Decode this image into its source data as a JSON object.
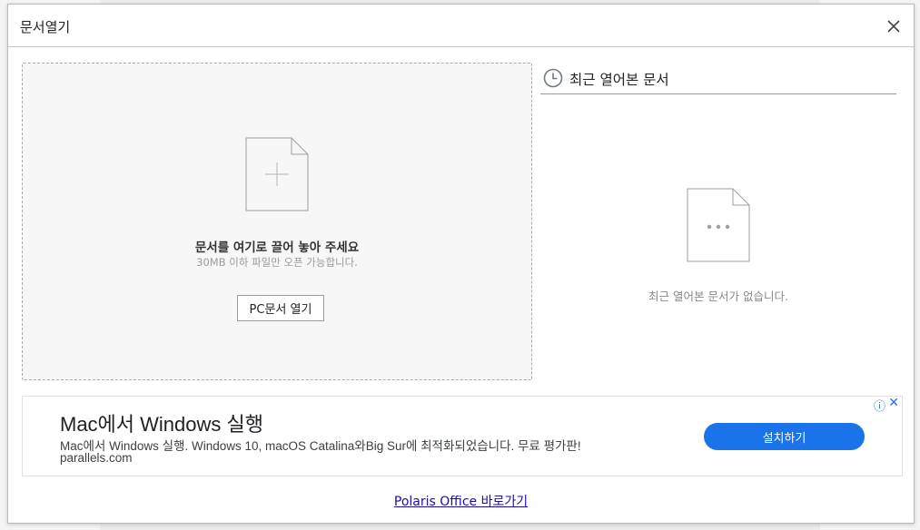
{
  "dialog": {
    "title": "문서열기",
    "close_icon": "close-icon"
  },
  "dropzone": {
    "icon": "add-document-icon",
    "title": "문서를 여기로 끌어 놓아 주세요",
    "subtitle": "30MB 이하 파일만 오픈 가능합니다.",
    "open_button": "PC문서 열기"
  },
  "recent": {
    "icon": "clock-icon",
    "title": "최근 열어본 문서",
    "empty_icon": "document-ellipsis-icon",
    "empty_text": "최근 열어본 문서가 없습니다."
  },
  "ad": {
    "title": "Mac에서 Windows 실행",
    "description": "Mac에서 Windows 실행. Windows 10, macOS Catalina와Big Sur에 최적화되었습니다. 무료 평가판!",
    "url": "parallels.com",
    "install_button": "설치하기",
    "info_icon": "ⓘ",
    "close_icon": "✕",
    "accent": "#1a73e8"
  },
  "footer": {
    "link": "Polaris Office 바로가기"
  }
}
